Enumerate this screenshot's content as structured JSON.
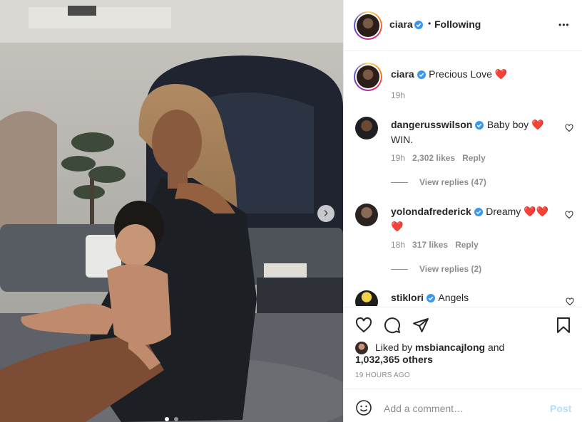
{
  "header": {
    "username": "ciara",
    "separator": "•",
    "follow_label": "Following",
    "more_label": "•••"
  },
  "caption": {
    "username": "ciara",
    "text": "Precious Love ❤️",
    "time": "19h"
  },
  "comments": [
    {
      "username": "dangerusswilson",
      "text": "Baby boy ❤️ WIN.",
      "time": "19h",
      "likes": "2,302 likes",
      "reply": "Reply",
      "view_replies": "View replies (47)"
    },
    {
      "username": "yolondafrederick",
      "text": "Dreamy ❤️❤️❤️",
      "time": "18h",
      "likes": "317 likes",
      "reply": "Reply",
      "view_replies": "View replies (2)"
    },
    {
      "username": "stiklori",
      "text": "Angels"
    }
  ],
  "likes": {
    "prefix": "Liked by",
    "user": "msbiancajlong",
    "and": "and",
    "others": "1,032,365 others"
  },
  "timestamp": "19 HOURS AGO",
  "comment_box": {
    "placeholder": "Add a comment…",
    "post_label": "Post"
  },
  "carousel": {
    "next_label": "›"
  },
  "colors": {
    "verified": "#3897f0",
    "post": "#b2dffc",
    "heart": "#ed4956"
  },
  "icons": [
    "like-icon",
    "comment-icon",
    "share-icon",
    "save-icon",
    "emoji-icon",
    "verified-icon",
    "chevron-right-icon"
  ]
}
